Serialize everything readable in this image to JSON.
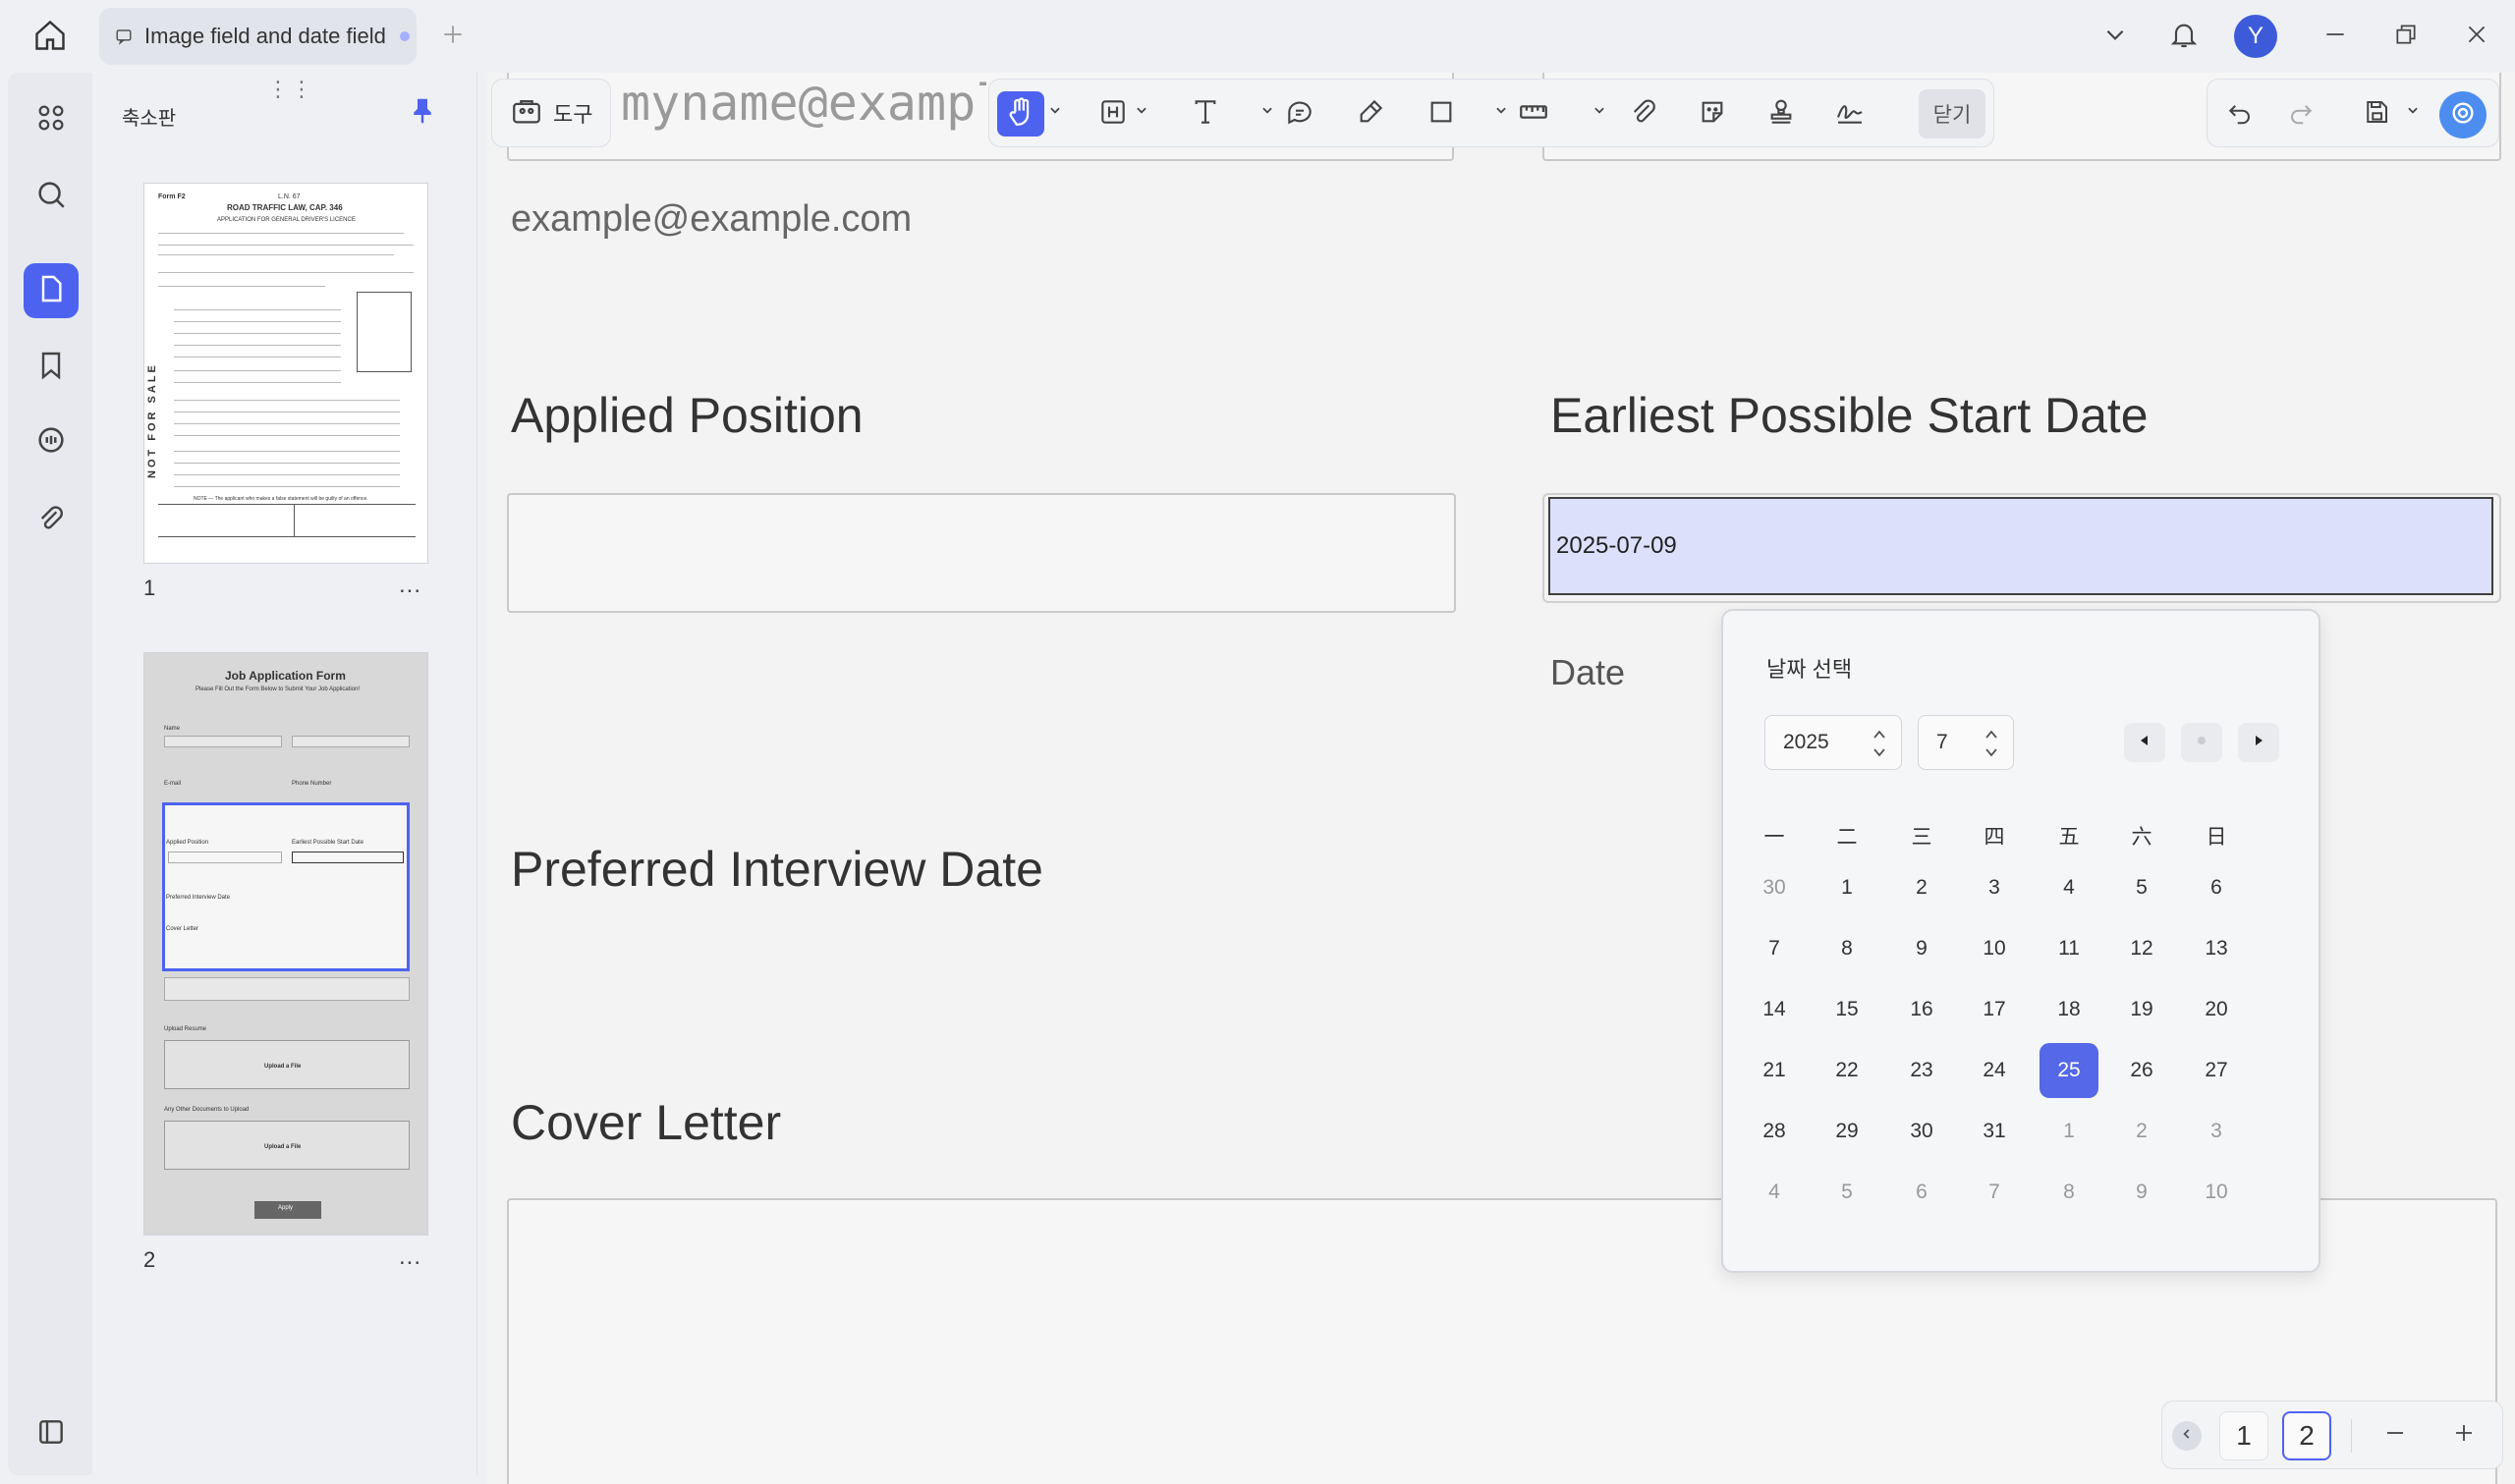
{
  "tab": {
    "title": "Image field and date field"
  },
  "avatar": {
    "initial": "Y"
  },
  "sidebar": {
    "title": "축소판",
    "pages": [
      {
        "number": "1",
        "more": "..."
      },
      {
        "number": "2",
        "more": "..."
      }
    ]
  },
  "thumb1": {
    "form": "Form F2",
    "ref": "L.N. 67",
    "title": "ROAD TRAFFIC LAW, CAP. 346",
    "subtitle": "APPLICATION FOR GENERAL DRIVER'S LICENCE",
    "side_text": "NOT FOR SALE",
    "note": "NOTE — The applicant who makes a false statement will be guilty of an offence."
  },
  "thumb2": {
    "title": "Job Application Form",
    "subtitle": "Please Fill Out the Form Below to Submit Your Job Application!",
    "name": "Name",
    "email": "E-mail",
    "phone": "Phone Number",
    "applied": "Applied Position",
    "earliest": "Earliest Possible Start Date",
    "interview": "Preferred Interview Date",
    "cover": "Cover Letter",
    "resume": "Upload Resume",
    "other": "Any Other Documents to Upload",
    "upload": "Upload a File",
    "apply": "Apply"
  },
  "toolbar": {
    "tools_label": "도구",
    "close_label": "닫기"
  },
  "document": {
    "email_placeholder": "myname@example.com",
    "email_example": "example@example.com",
    "applied_position": "Applied Position",
    "earliest_start": "Earliest Possible Start Date",
    "date_value": "2025-07-09",
    "date_caption": "Date",
    "preferred_interview": "Preferred Interview Date",
    "cover_letter": "Cover Letter"
  },
  "datepicker": {
    "title": "날짜 선택",
    "year": "2025",
    "month": "7",
    "weekdays": [
      "一",
      "二",
      "三",
      "四",
      "五",
      "六",
      "日"
    ],
    "days": [
      [
        "30",
        "1",
        "2",
        "3",
        "4",
        "5",
        "6"
      ],
      [
        "7",
        "8",
        "9",
        "10",
        "11",
        "12",
        "13"
      ],
      [
        "14",
        "15",
        "16",
        "17",
        "18",
        "19",
        "20"
      ],
      [
        "21",
        "22",
        "23",
        "24",
        "25",
        "26",
        "27"
      ],
      [
        "28",
        "29",
        "30",
        "31",
        "1",
        "2",
        "3"
      ],
      [
        "4",
        "5",
        "6",
        "7",
        "8",
        "9",
        "10"
      ]
    ],
    "selected": "25"
  },
  "pager": {
    "pages": [
      "1",
      "2"
    ],
    "current": "2"
  },
  "colors": {
    "accent": "#4d63f0",
    "selected_day": "#5468e8",
    "date_field_bg": "#dde0fb"
  }
}
